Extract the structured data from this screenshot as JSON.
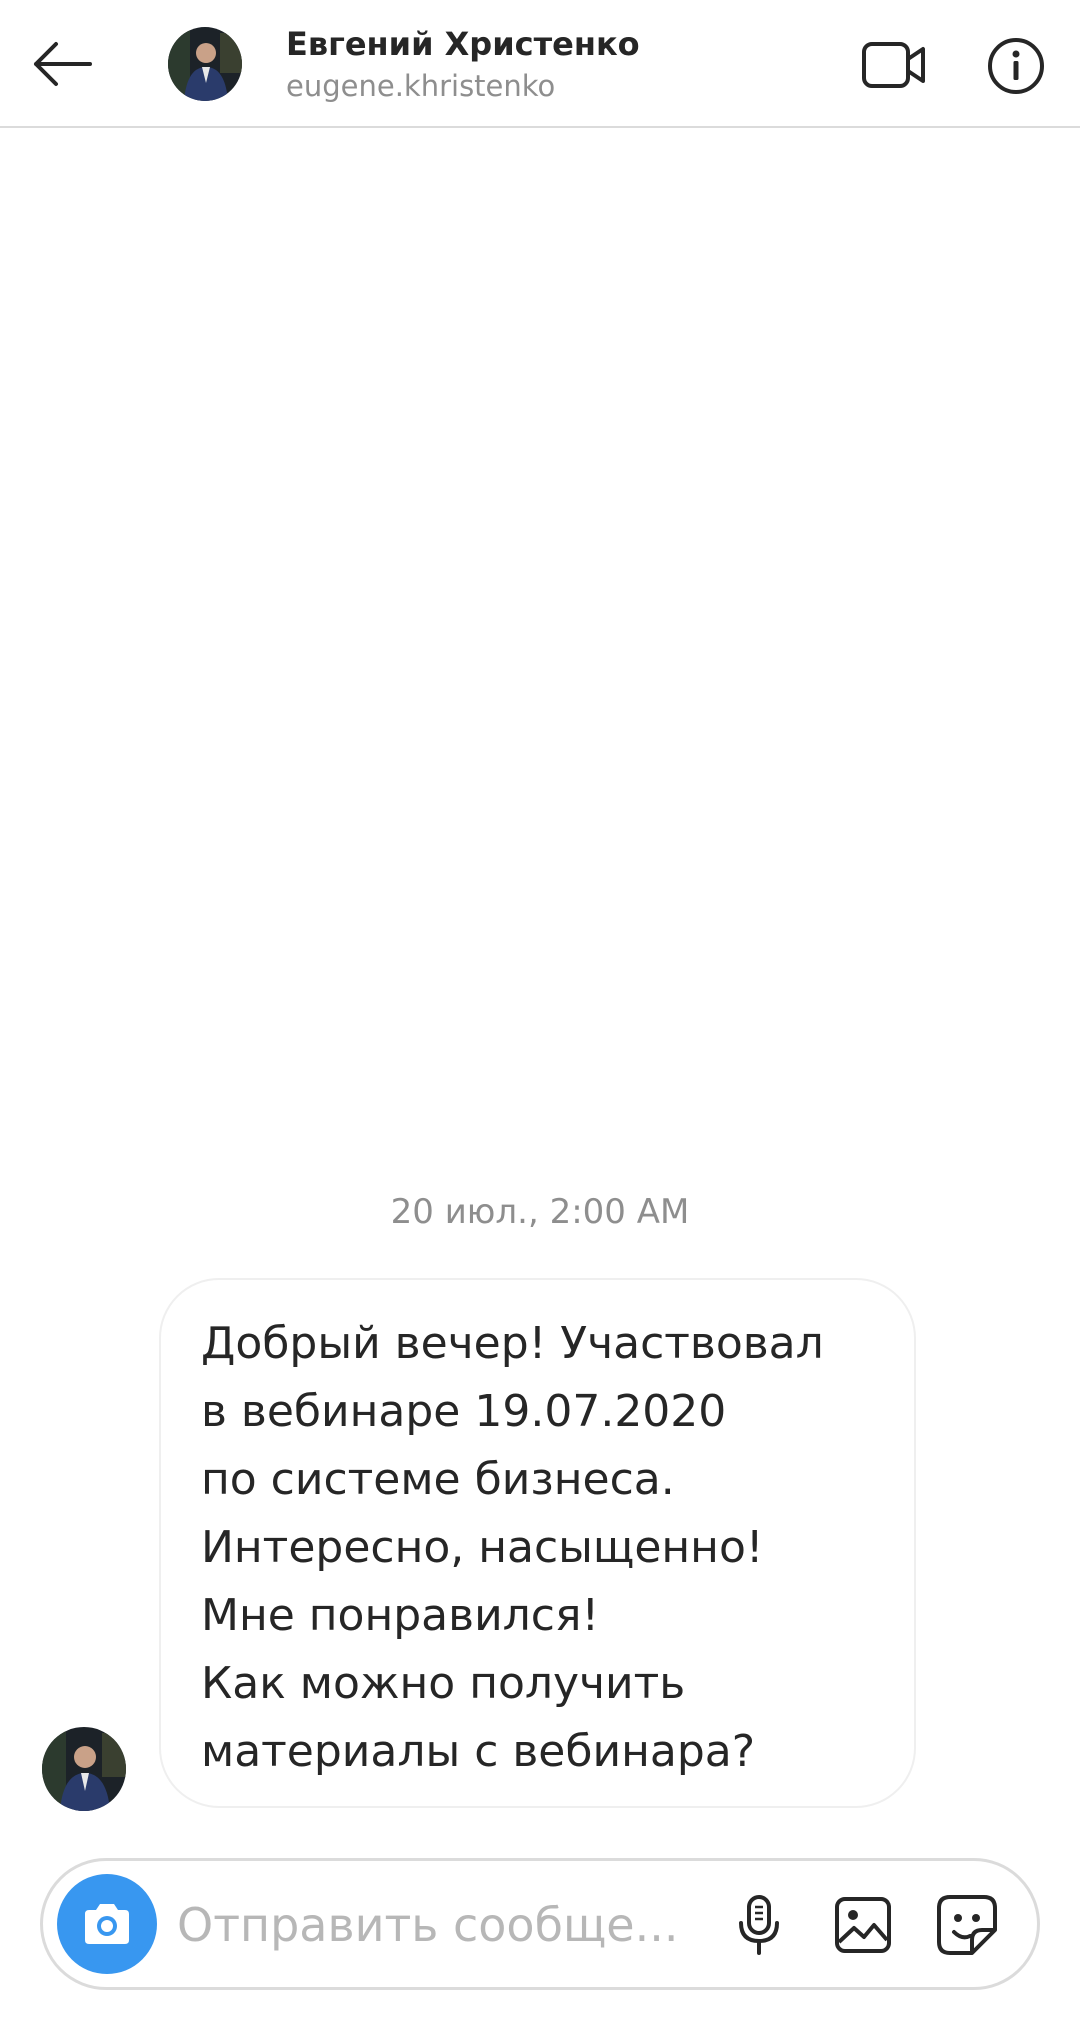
{
  "header": {
    "contact_name": "Евгений Христенко",
    "username": "eugene.khristenko",
    "back_icon": "arrow-left-icon",
    "video_icon": "video-camera-icon",
    "info_icon": "info-icon"
  },
  "thread": {
    "timestamp": "20 июл., 2:00 AM",
    "messages": [
      {
        "sender": "eugene.khristenko",
        "text": "Добрый вечер! Участвовал\nв вебинаре 19.07.2020\nпо системе бизнеса.\nИнтересно, насыщенно!\nМне понравился!\nКак можно получить\nматериалы с вебинара?"
      }
    ]
  },
  "composer": {
    "placeholder": "Отправить сообще...",
    "value": "",
    "camera_icon": "camera-icon",
    "mic_icon": "microphone-icon",
    "gallery_icon": "image-gallery-icon",
    "sticker_icon": "sticker-icon"
  },
  "colors": {
    "accent": "#3897f0",
    "text_primary": "#262626",
    "text_secondary": "#8e8e8e",
    "border": "#dbdbdb",
    "placeholder": "#b7b7b7"
  }
}
